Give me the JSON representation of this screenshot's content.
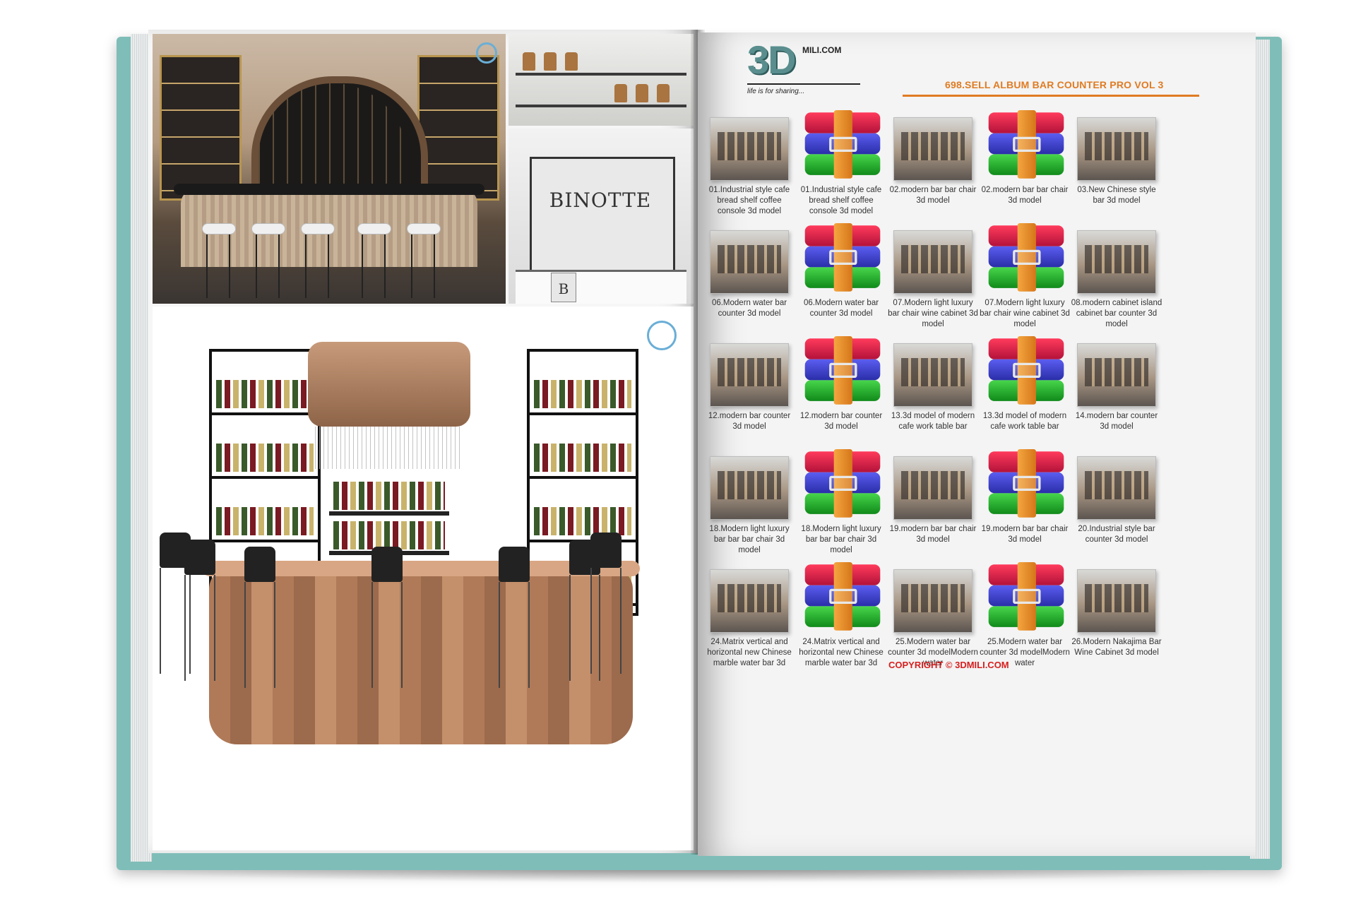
{
  "right_page": {
    "logo_text": "3D",
    "logo_domain": "MILI.COM",
    "tagline": "life is for sharing...",
    "album_title": "698.SELL ALBUM BAR COUNTER PRO VOL 3",
    "copyright": "COPYRIGHT © 3DMILI.COM",
    "items": [
      {
        "caption": "01.Industrial style cafe bread shelf coffee console 3d model",
        "thumb": "photo"
      },
      {
        "caption": "01.Industrial style cafe bread shelf coffee console 3d model",
        "thumb": "rar"
      },
      {
        "caption": "02.modern bar bar chair 3d model",
        "thumb": "photo"
      },
      {
        "caption": "02.modern bar bar chair 3d model",
        "thumb": "rar"
      },
      {
        "caption": "03.New Chinese style bar 3d model",
        "thumb": "photo"
      },
      {
        "caption": "06.Modern water bar counter 3d model",
        "thumb": "photo"
      },
      {
        "caption": "06.Modern water bar counter 3d model",
        "thumb": "rar"
      },
      {
        "caption": "07.Modern light luxury bar chair wine cabinet 3d model",
        "thumb": "photo"
      },
      {
        "caption": "07.Modern light luxury bar chair wine cabinet 3d model",
        "thumb": "rar"
      },
      {
        "caption": "08.modern cabinet island cabinet bar counter 3d model",
        "thumb": "photo"
      },
      {
        "caption": "12.modern bar counter 3d model",
        "thumb": "photo"
      },
      {
        "caption": "12.modern bar counter 3d model",
        "thumb": "rar"
      },
      {
        "caption": "13.3d model of modern cafe work table bar",
        "thumb": "photo"
      },
      {
        "caption": "13.3d model of modern cafe work table bar",
        "thumb": "rar"
      },
      {
        "caption": "14.modern bar counter 3d model",
        "thumb": "photo"
      },
      {
        "caption": "18.Modern light luxury bar bar bar chair 3d model",
        "thumb": "photo"
      },
      {
        "caption": "18.Modern light luxury bar bar bar chair 3d model",
        "thumb": "rar"
      },
      {
        "caption": "19.modern bar bar chair 3d model",
        "thumb": "photo"
      },
      {
        "caption": "19.modern bar bar chair 3d model",
        "thumb": "rar"
      },
      {
        "caption": "20.Industrial style bar counter 3d model",
        "thumb": "photo"
      },
      {
        "caption": "24.Matrix vertical and horizontal new Chinese marble water bar 3d",
        "thumb": "photo"
      },
      {
        "caption": "24.Matrix vertical and horizontal new Chinese marble water bar 3d",
        "thumb": "rar"
      },
      {
        "caption": "25.Modern water bar counter 3d modelModern water",
        "thumb": "photo"
      },
      {
        "caption": "25.Modern water bar counter 3d modelModern water",
        "thumb": "rar"
      },
      {
        "caption": "26.Modern Nakajima Bar Wine Cabinet 3d model",
        "thumb": "photo"
      }
    ]
  },
  "left_page": {
    "binotte_sign": "BINOTTE",
    "binotte_cup": "B"
  },
  "colors": {
    "accent_orange": "#e07b22",
    "copyright_red": "#d71e1e",
    "cover_teal": "#7fbdb8"
  }
}
